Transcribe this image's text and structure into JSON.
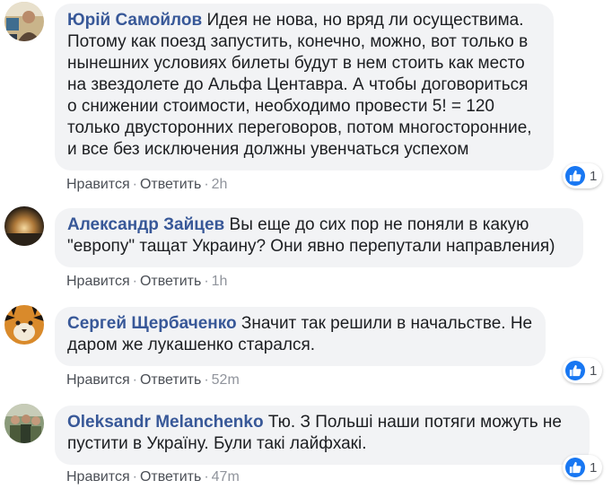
{
  "comments": [
    {
      "author": "Юрій Самойлов",
      "text": "Идея не нова, но вряд ли осуществима. Потому как поезд запустить, конечно, можно, вот только в нынешних условиях билеты будут в нем стоить как место на звездолете до Альфа Центавра. А чтобы договориться о снижении стоимости, необходимо провести 5! = 120 только двусторонних переговоров, потом многосторонние, и все без исключения должны увенчаться успехом",
      "like_label": "Нравится",
      "reply_label": "Ответить",
      "time": "2h",
      "reactions": {
        "icon": "thumbs-up-icon",
        "count": "1"
      }
    },
    {
      "author": "Александр Зайцев",
      "text": "Вы еще до сих пор не поняли в какую \"европу\" тащат Украину? Они явно перепутали направления)",
      "like_label": "Нравится",
      "reply_label": "Ответить",
      "time": "1h"
    },
    {
      "author": "Сергей Щербаченко",
      "text": "Значит так решили в начальстве. Не даром же лукашенко старался.",
      "like_label": "Нравится",
      "reply_label": "Ответить",
      "time": "52m",
      "reactions": {
        "icon": "thumbs-up-icon",
        "count": "1"
      }
    },
    {
      "author": "Oleksandr Melanchenko",
      "text": "Тю. З Польші наши потяги можуть не пустити в Україну. Були такі лайфхакі.",
      "like_label": "Нравится",
      "reply_label": "Ответить",
      "time": "47m",
      "reactions": {
        "icon": "thumbs-up-icon",
        "count": "1"
      }
    }
  ],
  "colors": {
    "author": "#385898",
    "bubble": "#f2f3f5",
    "action": "#4b4f56",
    "time": "#90949c",
    "like_blue": "#1877f2"
  }
}
